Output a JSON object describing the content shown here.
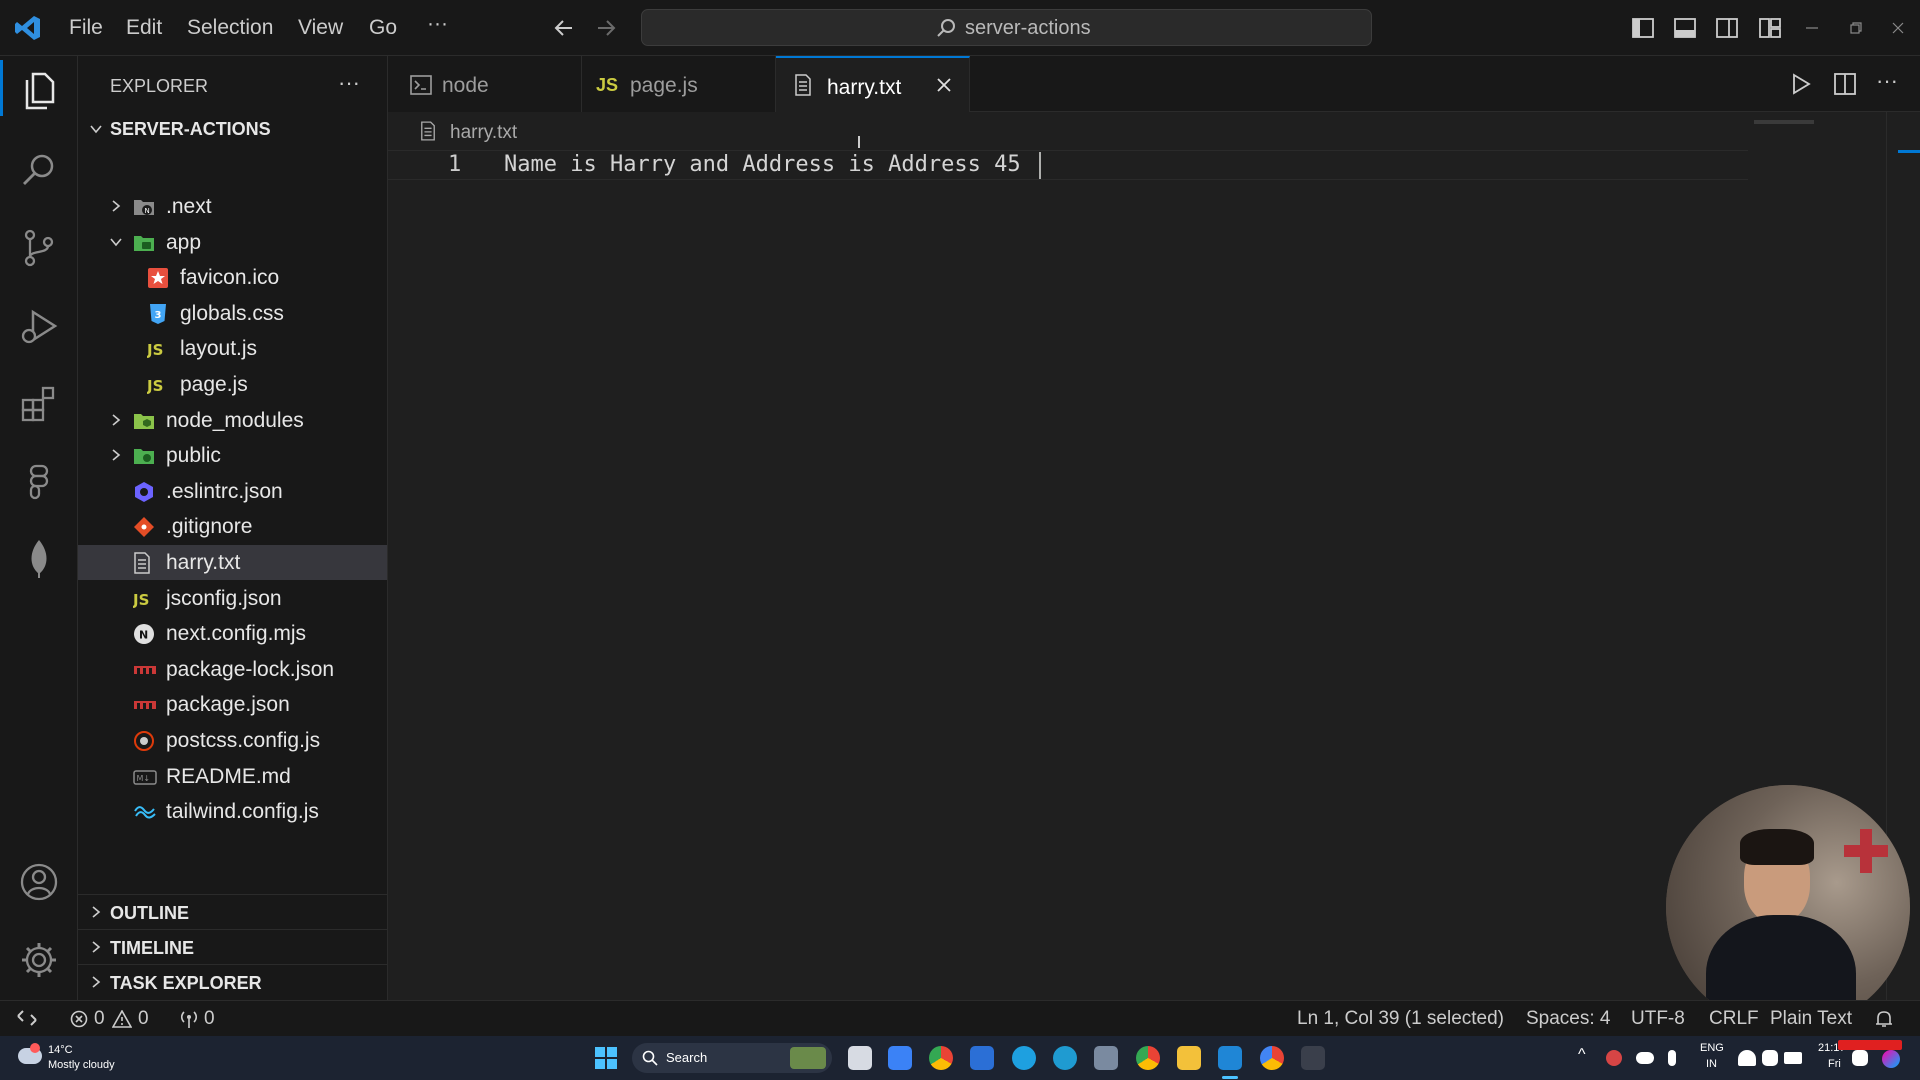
{
  "menu": {
    "file": "File",
    "edit": "Edit",
    "selection": "Selection",
    "view": "View",
    "go": "Go",
    "more": "···",
    "search_text": "server-actions"
  },
  "sidebar": {
    "title": "EXPLORER",
    "more": "···",
    "root": "SERVER-ACTIONS",
    "items": [
      {
        "label": ".next",
        "icon": "folder-next-icon",
        "kind": "folder",
        "expanded": false,
        "depth": 0
      },
      {
        "label": "app",
        "icon": "folder-app-icon",
        "kind": "folder",
        "expanded": true,
        "depth": 0
      },
      {
        "label": "favicon.ico",
        "icon": "star-icon",
        "kind": "file",
        "depth": 1
      },
      {
        "label": "globals.css",
        "icon": "css-icon",
        "kind": "file",
        "depth": 1
      },
      {
        "label": "layout.js",
        "icon": "js-icon",
        "kind": "file",
        "depth": 1
      },
      {
        "label": "page.js",
        "icon": "js-icon",
        "kind": "file",
        "depth": 1
      },
      {
        "label": "node_modules",
        "icon": "folder-node-icon",
        "kind": "folder",
        "expanded": false,
        "depth": 0
      },
      {
        "label": "public",
        "icon": "folder-public-icon",
        "kind": "folder",
        "expanded": false,
        "depth": 0
      },
      {
        "label": ".eslintrc.json",
        "icon": "eslint-icon",
        "kind": "file",
        "depth": 0
      },
      {
        "label": ".gitignore",
        "icon": "git-icon",
        "kind": "file",
        "depth": 0
      },
      {
        "label": "harry.txt",
        "icon": "text-file-icon",
        "kind": "file",
        "depth": 0,
        "selected": true
      },
      {
        "label": "jsconfig.json",
        "icon": "js-icon",
        "kind": "file",
        "depth": 0
      },
      {
        "label": "next.config.mjs",
        "icon": "next-icon",
        "kind": "file",
        "depth": 0
      },
      {
        "label": "package-lock.json",
        "icon": "npm-icon",
        "kind": "file",
        "depth": 0
      },
      {
        "label": "package.json",
        "icon": "npm-icon",
        "kind": "file",
        "depth": 0
      },
      {
        "label": "postcss.config.js",
        "icon": "postcss-icon",
        "kind": "file",
        "depth": 0
      },
      {
        "label": "README.md",
        "icon": "markdown-icon",
        "kind": "file",
        "depth": 0
      },
      {
        "label": "tailwind.config.js",
        "icon": "tailwind-icon",
        "kind": "file",
        "depth": 0
      }
    ],
    "sections": {
      "outline": "OUTLINE",
      "timeline": "TIMELINE",
      "task_explorer": "TASK EXPLORER"
    }
  },
  "tabs": [
    {
      "label": "node",
      "icon": "terminal-icon",
      "active": false
    },
    {
      "label": "page.js",
      "icon": "js-icon",
      "active": false
    },
    {
      "label": "harry.txt",
      "icon": "text-file-icon",
      "active": true
    }
  ],
  "editor": {
    "breadcrumb": "harry.txt",
    "line_number": "1",
    "code": "Name is Harry and Address is Address 45"
  },
  "status": {
    "errors": "0",
    "warnings": "0",
    "ports": "0",
    "position": "Ln 1, Col 39 (1 selected)",
    "spaces": "Spaces: 4",
    "encoding": "UTF-8",
    "eol": "CRLF",
    "language": "Plain Text"
  },
  "taskbar": {
    "temperature": "14°C",
    "weather": "Mostly cloudy",
    "search": "Search",
    "lang_top": "ENG",
    "lang_bottom": "IN",
    "time": "21:17",
    "day": "Fri"
  },
  "colors": {
    "accent": "#0078d4",
    "js": "#cbcb41",
    "folder_green": "#4caf50",
    "git": "#e44d26",
    "npm": "#cb3837"
  }
}
